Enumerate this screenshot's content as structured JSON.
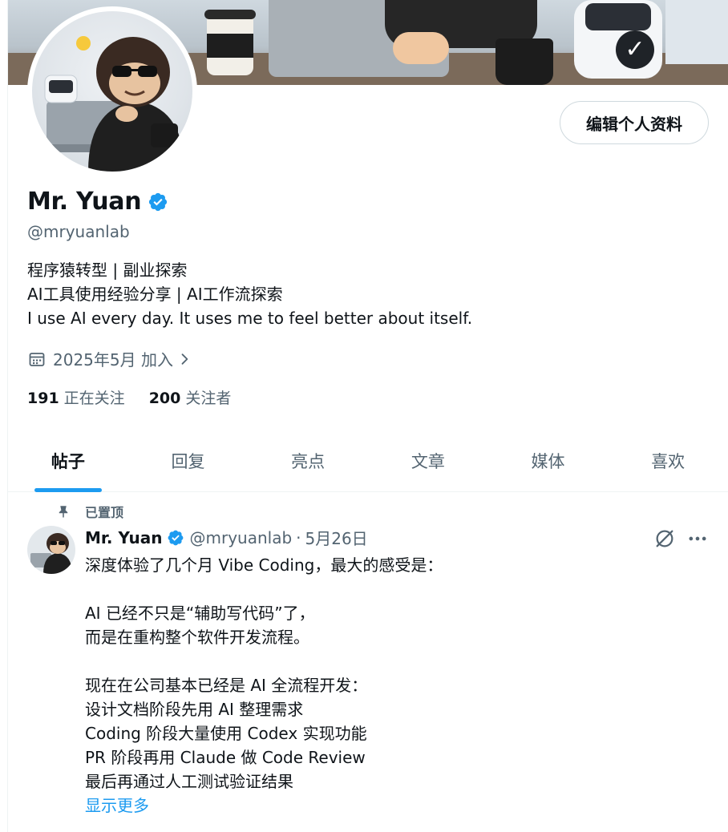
{
  "profile": {
    "edit_button": "编辑个人资料",
    "display_name": "Mr. Yuan",
    "handle": "@mryuanlab",
    "bio": [
      "程序猿转型 | 副业探索",
      "AI工具使用经验分享 | AI工作流探索",
      "I use AI every day. It uses me to feel better about itself."
    ],
    "joined": "2025年5月 加入",
    "following_count": "191",
    "following_label": "正在关注",
    "followers_count": "200",
    "followers_label": "关注者"
  },
  "tabs": [
    {
      "label": "帖子",
      "active": true
    },
    {
      "label": "回复",
      "active": false
    },
    {
      "label": "亮点",
      "active": false
    },
    {
      "label": "文章",
      "active": false
    },
    {
      "label": "媒体",
      "active": false
    },
    {
      "label": "喜欢",
      "active": false
    }
  ],
  "pinned_post": {
    "pinned_label": "已置顶",
    "author_name": "Mr. Yuan",
    "author_handle": "@mryuanlab",
    "separator": "·",
    "date": "5月26日",
    "body_lines": [
      "深度体验了几个月 Vibe Coding，最大的感受是：",
      "",
      "AI 已经不只是“辅助写代码”了，",
      "而是在重构整个软件开发流程。",
      "",
      "现在在公司基本已经是 AI 全流程开发：",
      "设计文档阶段先用 AI 整理需求",
      "Coding 阶段大量使用 Codex 实现功能",
      "PR 阶段再用 Claude 做 Code Review",
      "最后再通过人工测试验证结果"
    ],
    "show_more": "显示更多"
  },
  "icons": {
    "verified": "verified-badge-icon",
    "calendar": "calendar-icon",
    "chevron": "chevron-right-icon",
    "pin": "pin-icon",
    "grok": "grok-icon",
    "more": "more-icon"
  },
  "colors": {
    "accent": "#1d9bf0",
    "text_primary": "#0f1419",
    "text_secondary": "#536471",
    "border": "#cfd9de"
  }
}
